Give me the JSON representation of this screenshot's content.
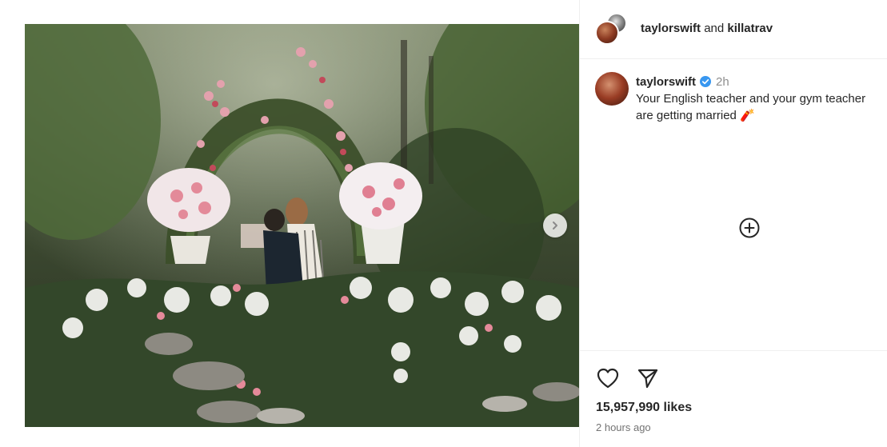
{
  "post": {
    "header": {
      "user1": "taylorswift",
      "connector": "and",
      "user2": "killatrav"
    },
    "caption": {
      "username": "taylorswift",
      "time": "2h",
      "text": "Your English teacher and your gym teacher are getting married 🧨"
    },
    "likes": "15,957,990 likes",
    "posted_ago": "2 hours ago"
  },
  "icons": {
    "verified": "verified-badge-icon",
    "add": "circle-plus-icon",
    "like": "heart-icon",
    "share": "paper-plane-icon",
    "next": "chevron-right-icon"
  },
  "colors": {
    "verified_blue": "#3897f0",
    "divider": "#efefef",
    "muted_text": "#737373"
  }
}
